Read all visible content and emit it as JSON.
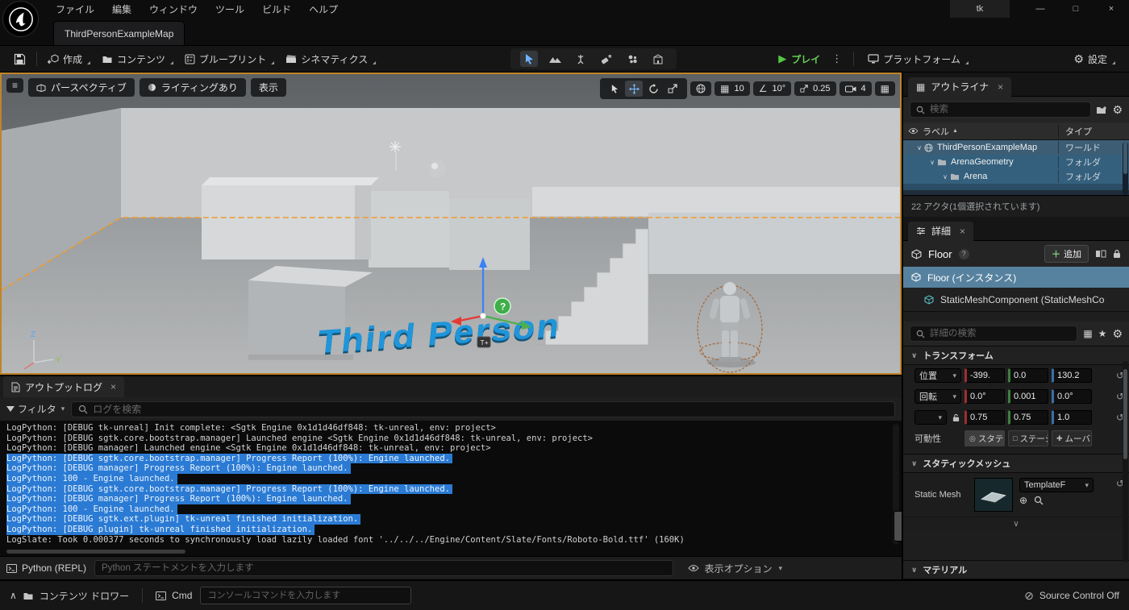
{
  "icons": {
    "hamburger": "≡",
    "caret": "▾",
    "chevron_down": "∨",
    "close": "×",
    "gear": "⚙",
    "kebab": "⋮",
    "play": "▶",
    "grid": "▦",
    "angle": "∠",
    "reset": "↺",
    "star": "★",
    "slash_circle": "⊘",
    "chevron_up": "∧",
    "minimize": "—",
    "maximize": "□",
    "question": "?",
    "sort_asc": "▲",
    "circle": "◎",
    "square": "□",
    "cross": "✚",
    "plus_circle": "⊕",
    "plus": "＋"
  },
  "menubar": {
    "items": [
      "ファイル",
      "編集",
      "ウィンドウ",
      "ツール",
      "ビルド",
      "ヘルプ"
    ],
    "project": "tk"
  },
  "tab": {
    "active": "ThirdPersonExampleMap"
  },
  "toolbar": {
    "create": "作成",
    "content": "コンテンツ",
    "blueprint": "ブループリント",
    "cinematics": "シネマティクス",
    "play": "プレイ",
    "platforms": "プラットフォーム",
    "settings": "設定"
  },
  "viewport": {
    "perspective": "パースペクティブ",
    "lit": "ライティングあり",
    "show": "表示",
    "grid_snap": "10",
    "angle_snap": "10°",
    "scale_snap": "0.25",
    "camera_speed": "4",
    "scene_text": "Third Person",
    "axis_z": "Z",
    "axis_y": "Y"
  },
  "outliner": {
    "title": "アウトライナ",
    "search_placeholder": "検索",
    "column_label": "ラベル",
    "column_type": "タイプ",
    "rows": [
      {
        "label": "ThirdPersonExampleMap",
        "type": "ワールド"
      },
      {
        "label": "ArenaGeometry",
        "type": "フォルダ"
      },
      {
        "label": "Arena",
        "type": "フォルダ"
      }
    ],
    "status": "22 アクタ(1個選択されています)"
  },
  "details": {
    "title": "詳細",
    "object_name": "Floor",
    "add_button": "追加",
    "instance_row": "Floor (インスタンス)",
    "component_row": "StaticMeshComponent (StaticMeshCo",
    "search_placeholder": "詳細の検索",
    "transform": {
      "header": "トランスフォーム",
      "location_label": "位置",
      "rotation_label": "回転",
      "location": [
        "-399.",
        "0.0",
        "130.2"
      ],
      "rotation": [
        "0.0°",
        "0.001",
        "0.0°"
      ],
      "scale": [
        "0.75",
        "0.75",
        "1.0"
      ],
      "mobility_label": "可動性",
      "mobility_options": [
        "スタティック",
        "ステーショナリ",
        "ムーバブル"
      ]
    },
    "static_mesh": {
      "header": "スタティックメッシュ",
      "label": "Static Mesh",
      "value": "TemplateF"
    },
    "materials": {
      "header": "マテリアル"
    }
  },
  "output_log": {
    "tab": "アウトプットログ",
    "filter_label": "フィルタ",
    "search_placeholder": "ログを検索",
    "lines": [
      {
        "text": "LogPython: [DEBUG tk-unreal] Init complete: <Sgtk Engine 0x1d1d46df848: tk-unreal, env: project>",
        "highlighted": false
      },
      {
        "text": "LogPython: [DEBUG sgtk.core.bootstrap.manager] Launched engine <Sgtk Engine 0x1d1d46df848: tk-unreal, env: project>",
        "highlighted": false
      },
      {
        "text": "LogPython: [DEBUG manager] Launched engine <Sgtk Engine 0x1d1d46df848: tk-unreal, env: project>",
        "highlighted": false
      },
      {
        "text": "LogPython: [DEBUG sgtk.core.bootstrap.manager] Progress Report (100%): Engine launched.",
        "highlighted": true
      },
      {
        "text": "LogPython: [DEBUG manager] Progress Report (100%): Engine launched.",
        "highlighted": true
      },
      {
        "text": "LogPython: 100 - Engine launched.",
        "highlighted": true
      },
      {
        "text": "LogPython: [DEBUG sgtk.core.bootstrap.manager] Progress Report (100%): Engine launched.",
        "highlighted": true
      },
      {
        "text": "LogPython: [DEBUG manager] Progress Report (100%): Engine launched.",
        "highlighted": true
      },
      {
        "text": "LogPython: 100 - Engine launched.",
        "highlighted": true
      },
      {
        "text": "LogPython: [DEBUG sgtk.ext.plugin] tk-unreal finished initialization.",
        "highlighted": true
      },
      {
        "text": "LogPython: [DEBUG plugin] tk-unreal finished initialization.",
        "highlighted": true
      },
      {
        "text": "LogSlate: Took 0.000377 seconds to synchronously load lazily loaded font '../../../Engine/Content/Slate/Fonts/Roboto-Bold.ttf' (160K)",
        "highlighted": false
      }
    ]
  },
  "python": {
    "label": "Python (REPL)",
    "placeholder": "Python ステートメントを入力します",
    "display_options": "表示オプション"
  },
  "statusbar": {
    "content_drawer": "コンテンツ ドロワー",
    "cmd": "Cmd",
    "console_placeholder": "コンソールコマンドを入力します",
    "source_control": "Source Control Off"
  }
}
